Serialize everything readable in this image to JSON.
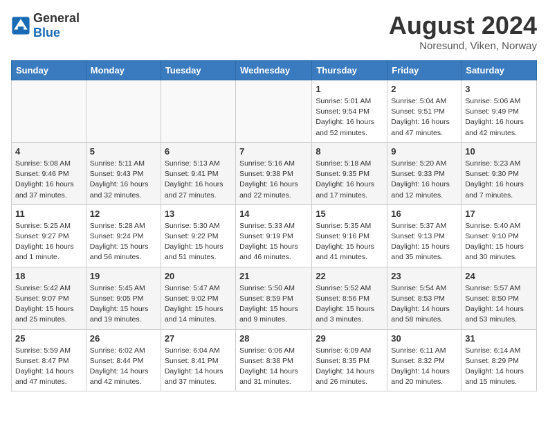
{
  "header": {
    "logo_general": "General",
    "logo_blue": "Blue",
    "month_title": "August 2024",
    "location": "Noresund, Viken, Norway"
  },
  "days_of_week": [
    "Sunday",
    "Monday",
    "Tuesday",
    "Wednesday",
    "Thursday",
    "Friday",
    "Saturday"
  ],
  "weeks": [
    [
      {
        "day": "",
        "info": ""
      },
      {
        "day": "",
        "info": ""
      },
      {
        "day": "",
        "info": ""
      },
      {
        "day": "",
        "info": ""
      },
      {
        "day": "1",
        "info": "Sunrise: 5:01 AM\nSunset: 9:54 PM\nDaylight: 16 hours\nand 52 minutes."
      },
      {
        "day": "2",
        "info": "Sunrise: 5:04 AM\nSunset: 9:51 PM\nDaylight: 16 hours\nand 47 minutes."
      },
      {
        "day": "3",
        "info": "Sunrise: 5:06 AM\nSunset: 9:49 PM\nDaylight: 16 hours\nand 42 minutes."
      }
    ],
    [
      {
        "day": "4",
        "info": "Sunrise: 5:08 AM\nSunset: 9:46 PM\nDaylight: 16 hours\nand 37 minutes."
      },
      {
        "day": "5",
        "info": "Sunrise: 5:11 AM\nSunset: 9:43 PM\nDaylight: 16 hours\nand 32 minutes."
      },
      {
        "day": "6",
        "info": "Sunrise: 5:13 AM\nSunset: 9:41 PM\nDaylight: 16 hours\nand 27 minutes."
      },
      {
        "day": "7",
        "info": "Sunrise: 5:16 AM\nSunset: 9:38 PM\nDaylight: 16 hours\nand 22 minutes."
      },
      {
        "day": "8",
        "info": "Sunrise: 5:18 AM\nSunset: 9:35 PM\nDaylight: 16 hours\nand 17 minutes."
      },
      {
        "day": "9",
        "info": "Sunrise: 5:20 AM\nSunset: 9:33 PM\nDaylight: 16 hours\nand 12 minutes."
      },
      {
        "day": "10",
        "info": "Sunrise: 5:23 AM\nSunset: 9:30 PM\nDaylight: 16 hours\nand 7 minutes."
      }
    ],
    [
      {
        "day": "11",
        "info": "Sunrise: 5:25 AM\nSunset: 9:27 PM\nDaylight: 16 hours\nand 1 minute."
      },
      {
        "day": "12",
        "info": "Sunrise: 5:28 AM\nSunset: 9:24 PM\nDaylight: 15 hours\nand 56 minutes."
      },
      {
        "day": "13",
        "info": "Sunrise: 5:30 AM\nSunset: 9:22 PM\nDaylight: 15 hours\nand 51 minutes."
      },
      {
        "day": "14",
        "info": "Sunrise: 5:33 AM\nSunset: 9:19 PM\nDaylight: 15 hours\nand 46 minutes."
      },
      {
        "day": "15",
        "info": "Sunrise: 5:35 AM\nSunset: 9:16 PM\nDaylight: 15 hours\nand 41 minutes."
      },
      {
        "day": "16",
        "info": "Sunrise: 5:37 AM\nSunset: 9:13 PM\nDaylight: 15 hours\nand 35 minutes."
      },
      {
        "day": "17",
        "info": "Sunrise: 5:40 AM\nSunset: 9:10 PM\nDaylight: 15 hours\nand 30 minutes."
      }
    ],
    [
      {
        "day": "18",
        "info": "Sunrise: 5:42 AM\nSunset: 9:07 PM\nDaylight: 15 hours\nand 25 minutes."
      },
      {
        "day": "19",
        "info": "Sunrise: 5:45 AM\nSunset: 9:05 PM\nDaylight: 15 hours\nand 19 minutes."
      },
      {
        "day": "20",
        "info": "Sunrise: 5:47 AM\nSunset: 9:02 PM\nDaylight: 15 hours\nand 14 minutes."
      },
      {
        "day": "21",
        "info": "Sunrise: 5:50 AM\nSunset: 8:59 PM\nDaylight: 15 hours\nand 9 minutes."
      },
      {
        "day": "22",
        "info": "Sunrise: 5:52 AM\nSunset: 8:56 PM\nDaylight: 15 hours\nand 3 minutes."
      },
      {
        "day": "23",
        "info": "Sunrise: 5:54 AM\nSunset: 8:53 PM\nDaylight: 14 hours\nand 58 minutes."
      },
      {
        "day": "24",
        "info": "Sunrise: 5:57 AM\nSunset: 8:50 PM\nDaylight: 14 hours\nand 53 minutes."
      }
    ],
    [
      {
        "day": "25",
        "info": "Sunrise: 5:59 AM\nSunset: 8:47 PM\nDaylight: 14 hours\nand 47 minutes."
      },
      {
        "day": "26",
        "info": "Sunrise: 6:02 AM\nSunset: 8:44 PM\nDaylight: 14 hours\nand 42 minutes."
      },
      {
        "day": "27",
        "info": "Sunrise: 6:04 AM\nSunset: 8:41 PM\nDaylight: 14 hours\nand 37 minutes."
      },
      {
        "day": "28",
        "info": "Sunrise: 6:06 AM\nSunset: 8:38 PM\nDaylight: 14 hours\nand 31 minutes."
      },
      {
        "day": "29",
        "info": "Sunrise: 6:09 AM\nSunset: 8:35 PM\nDaylight: 14 hours\nand 26 minutes."
      },
      {
        "day": "30",
        "info": "Sunrise: 6:11 AM\nSunset: 8:32 PM\nDaylight: 14 hours\nand 20 minutes."
      },
      {
        "day": "31",
        "info": "Sunrise: 6:14 AM\nSunset: 8:29 PM\nDaylight: 14 hours\nand 15 minutes."
      }
    ]
  ]
}
